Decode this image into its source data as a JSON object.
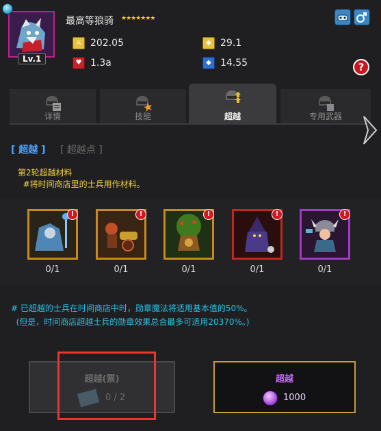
{
  "unit": {
    "name": "最高等狼骑",
    "stars": "★★★★★★★",
    "level": "Lv.1"
  },
  "stats": {
    "attack": "202.05",
    "defense": "29.1",
    "hp": "1.3a",
    "shield": "14.55"
  },
  "help_label": "?",
  "tabs": [
    {
      "label": "详情",
      "icon": "helmet-document-icon"
    },
    {
      "label": "技能",
      "icon": "helmet-burst-icon"
    },
    {
      "label": "超越",
      "icon": "helmet-arrows-up-icon"
    },
    {
      "label": "专用武器",
      "icon": "helmet-weapon-icon"
    }
  ],
  "active_tab": "超越",
  "subtabs": {
    "active": "[ 超越 ]",
    "inactive": "[ 超越点 ]"
  },
  "materials_title_line1": "第2轮超越材料",
  "materials_title_line2": "  #将时间商店里的士兵用作材料。",
  "materials": [
    {
      "count": "0/1",
      "border": "#c88a1e"
    },
    {
      "count": "0/1",
      "border": "#c88a1e"
    },
    {
      "count": "0/1",
      "border": "#c88a1e"
    },
    {
      "count": "0/1",
      "border": "#c0281e"
    },
    {
      "count": "0/1",
      "border": "#a23ac6"
    }
  ],
  "alert_mark": "!",
  "note_line1": "# 已超越的士兵在时间商店中时，勋章魔法将适用基本值的50%。",
  "note_line2": "  (但是，时间商店超越士兵的勋章效果总合最多可适用20370%。)",
  "ticket_button": {
    "label": "超越(票)",
    "count": "0 / 2"
  },
  "transcend_button": {
    "label": "超越",
    "cost": "1000"
  }
}
